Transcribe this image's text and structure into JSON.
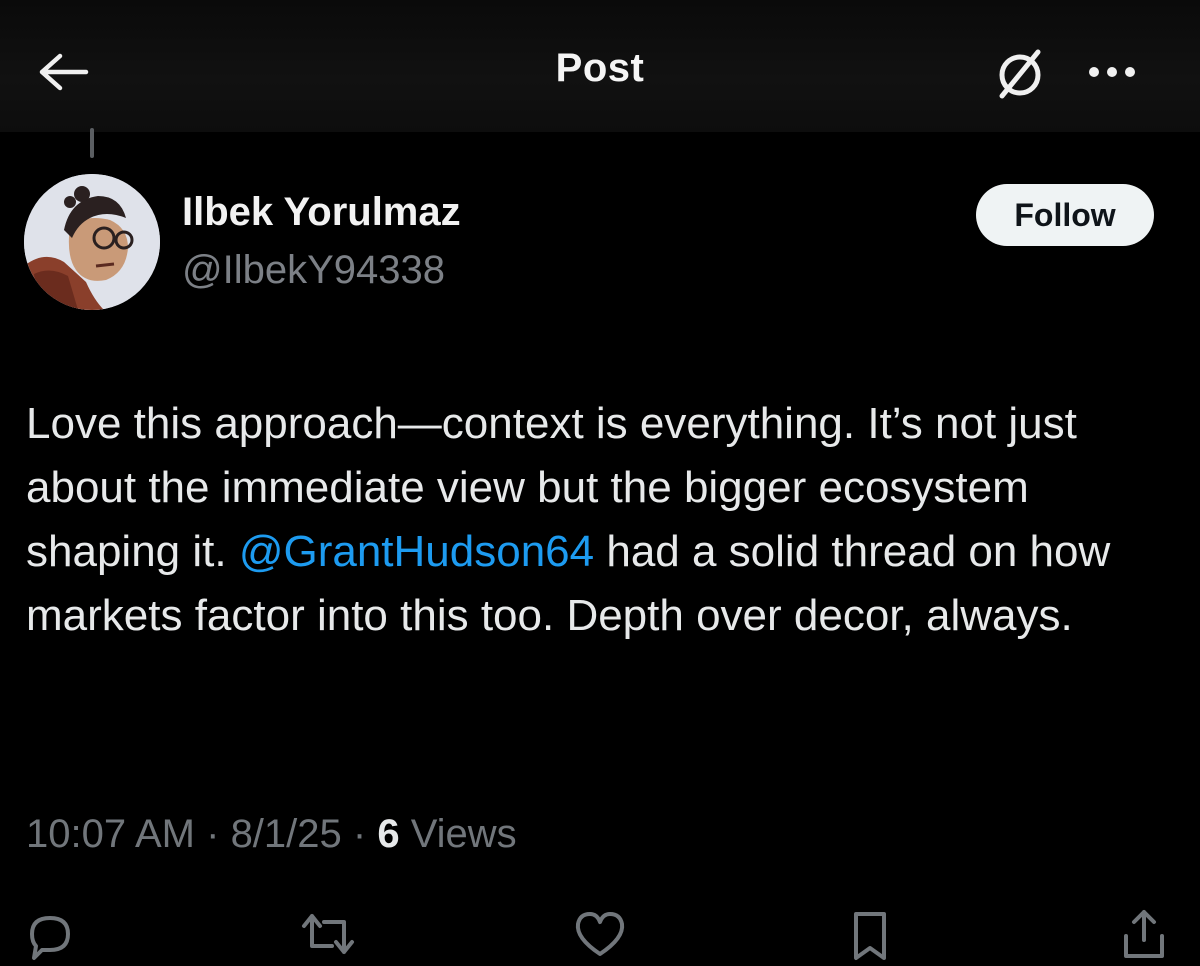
{
  "header": {
    "title": "Post",
    "back_icon": "arrow-left-icon",
    "grok_icon": "grok-icon",
    "more_icon": "more-dots-icon"
  },
  "author": {
    "display_name": "Ilbek Yorulmaz",
    "handle": "@IlbekY94338",
    "avatar_icon": "avatar-illustration"
  },
  "follow_label": "Follow",
  "post": {
    "text_before": "Love this approach—context is everything. It’s not just about the immediate view but the bigger ecosystem shaping it. ",
    "mention": "@GrantHudson64",
    "text_after": " had a solid thread on how markets factor into this too. Depth over decor, always."
  },
  "meta": {
    "time": "10:07 AM",
    "separator": " · ",
    "date": "8/1/25",
    "views_count": "6",
    "views_label": " Views"
  },
  "actions": {
    "reply_icon": "reply-icon",
    "repost_icon": "repost-icon",
    "like_icon": "heart-icon",
    "bookmark_icon": "bookmark-icon",
    "share_icon": "share-icon"
  },
  "colors": {
    "background": "#000000",
    "text": "#e7e9ea",
    "muted": "#71767b",
    "link": "#1d9bf0",
    "follow_bg": "#eff3f4"
  }
}
